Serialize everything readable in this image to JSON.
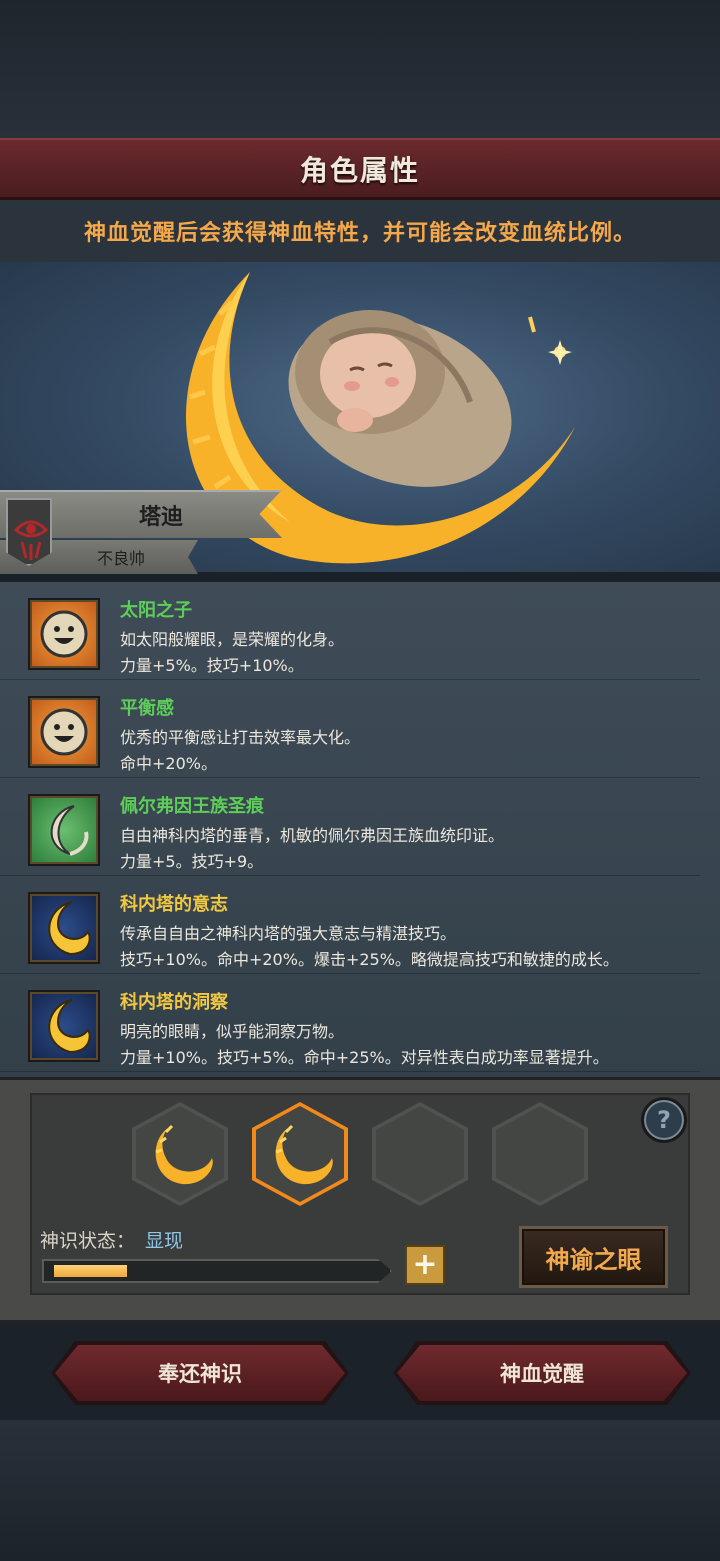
{
  "header": {
    "title": "角色属性"
  },
  "hint": "神血觉醒后会获得神血特性，并可能会改变血统比例。",
  "character": {
    "name": "塔迪",
    "title": "不良帅"
  },
  "traits": [
    {
      "name": "太阳之子",
      "name_color": "#5dcf58",
      "desc": "如太阳般耀眼，是荣耀的化身。",
      "stats": "力量+5%。技巧+10%。",
      "icon": "smiley-sun-icon"
    },
    {
      "name": "平衡感",
      "name_color": "#5dcf58",
      "desc": "优秀的平衡感让打击效率最大化。",
      "stats": "命中+20%。",
      "icon": "smiley-sun-icon"
    },
    {
      "name": "佩尔弗因王族圣痕",
      "name_color": "#5dcf58",
      "desc": "自由神科内塔的垂青，机敏的佩尔弗因王族血统印证。",
      "stats": "力量+5。技巧+9。",
      "icon": "crescent-leaf-icon"
    },
    {
      "name": "科内塔的意志",
      "name_color": "#f0c842",
      "desc": "传承自自由之神科内塔的强大意志与精湛技巧。",
      "stats": "技巧+10%。命中+20%。爆击+25%。略微提高技巧和敏捷的成长。",
      "icon": "golden-moon-icon"
    },
    {
      "name": "科内塔的洞察",
      "name_color": "#f0c842",
      "desc": "明亮的眼睛，似乎能洞察万物。",
      "stats": "力量+10%。技巧+5%。命中+25%。对异性表白成功率显著提升。",
      "icon": "golden-moon-icon"
    }
  ],
  "divine": {
    "status_label": "神识状态：",
    "status_value": "显现",
    "progress": 0.22,
    "help_label": "?",
    "plus_label": "+",
    "oracle_button": "神谕之眼",
    "slots": [
      "golden-moon-slot",
      "golden-moon-slot-selected",
      "empty-slot",
      "empty-slot"
    ]
  },
  "actions": {
    "return_label": "奉还神识",
    "awaken_label": "神血觉醒"
  },
  "colors": {
    "accent": "#f5a84a",
    "banner": "#6b2a2e",
    "green": "#5dcf58",
    "gold": "#f0c842"
  }
}
